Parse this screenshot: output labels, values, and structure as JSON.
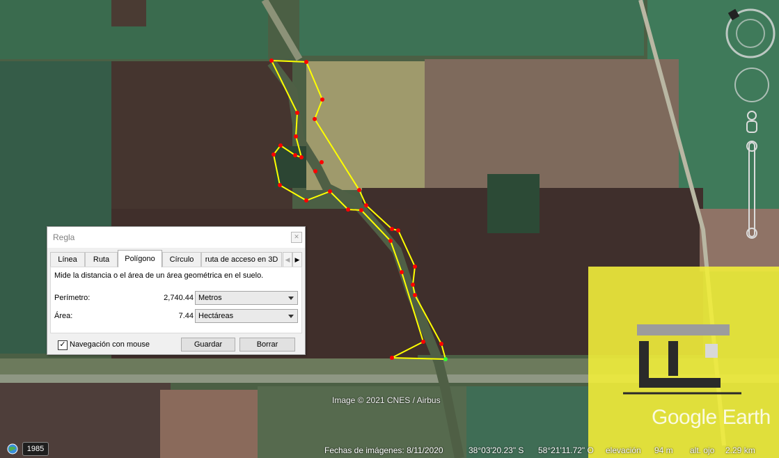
{
  "dialog": {
    "title": "Regla",
    "close_icon": "close-icon",
    "tabs": [
      "Línea",
      "Ruta",
      "Polígono",
      "Círculo",
      "ruta de acceso en 3D"
    ],
    "active_tab": "Polígono",
    "description": "Mide la distancia o el área de un área geométrica en el suelo.",
    "perimeter_label": "Perímetro:",
    "perimeter_value": "2,740.44",
    "perimeter_unit": "Metros",
    "area_label": "Área:",
    "area_value": "7.44",
    "area_unit": "Hectáreas",
    "nav_checkbox_label": "Navegación con mouse",
    "nav_checked": true,
    "save_label": "Guardar",
    "clear_label": "Borrar"
  },
  "map": {
    "credit": "Image © 2021 CNES / Airbus",
    "watermark": "Google Earth",
    "polygon_color": "#ffff00",
    "vertex_color": "#ff0000"
  },
  "status": {
    "year": "1985",
    "imagery_date": "Fechas de imágenes: 8/11/2020",
    "lat": "38°03'20.23\" S",
    "lon": "58°21'11.72\" O",
    "elevation_label": "elevación",
    "elevation_value": "94 m",
    "eye_alt_label": "alt. ojo",
    "eye_alt_value": "2.29 km"
  },
  "controls": {
    "compass_icon": "compass-north-icon",
    "look_icon": "look-joystick-icon",
    "streetview_icon": "pegman-icon",
    "zoom_icon": "zoom-slider-icon"
  }
}
